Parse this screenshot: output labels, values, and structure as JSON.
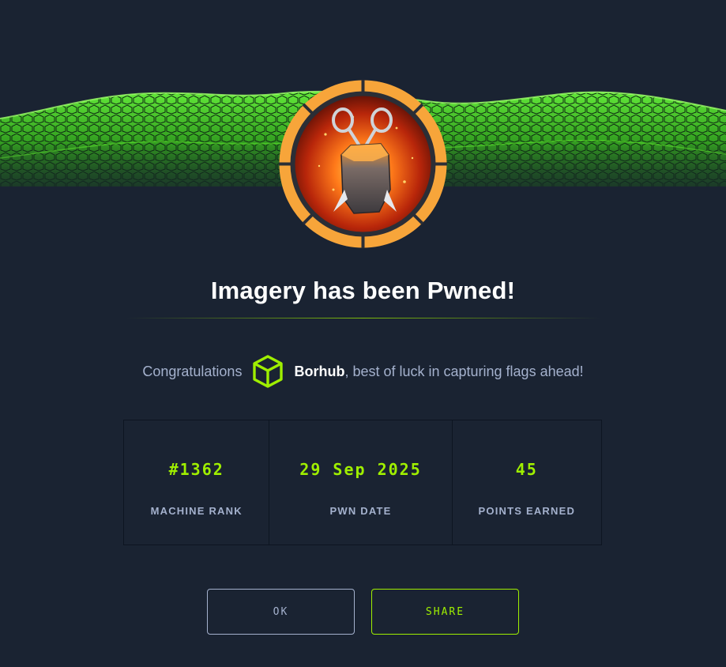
{
  "modal": {
    "title": "Imagery has been Pwned!",
    "congrats_prefix": "Congratulations",
    "username": "Borhub",
    "congrats_suffix": ", best of luck in capturing flags ahead!"
  },
  "stats": [
    {
      "value": "#1362",
      "label": "MACHINE RANK"
    },
    {
      "value": "29 Sep 2025",
      "label": "PWN DATE"
    },
    {
      "value": "45",
      "label": "POINTS EARNED"
    }
  ],
  "buttons": {
    "ok_label": "OK",
    "share_label": "SHARE"
  },
  "icons": {
    "badge": "machine-badge-icon",
    "avatar": "hexagon-cube-avatar-icon"
  },
  "colors": {
    "background": "#1a2332",
    "accent": "#9fef00",
    "badge_ring": "#f7a53a",
    "muted_text": "#a4b1cd"
  }
}
